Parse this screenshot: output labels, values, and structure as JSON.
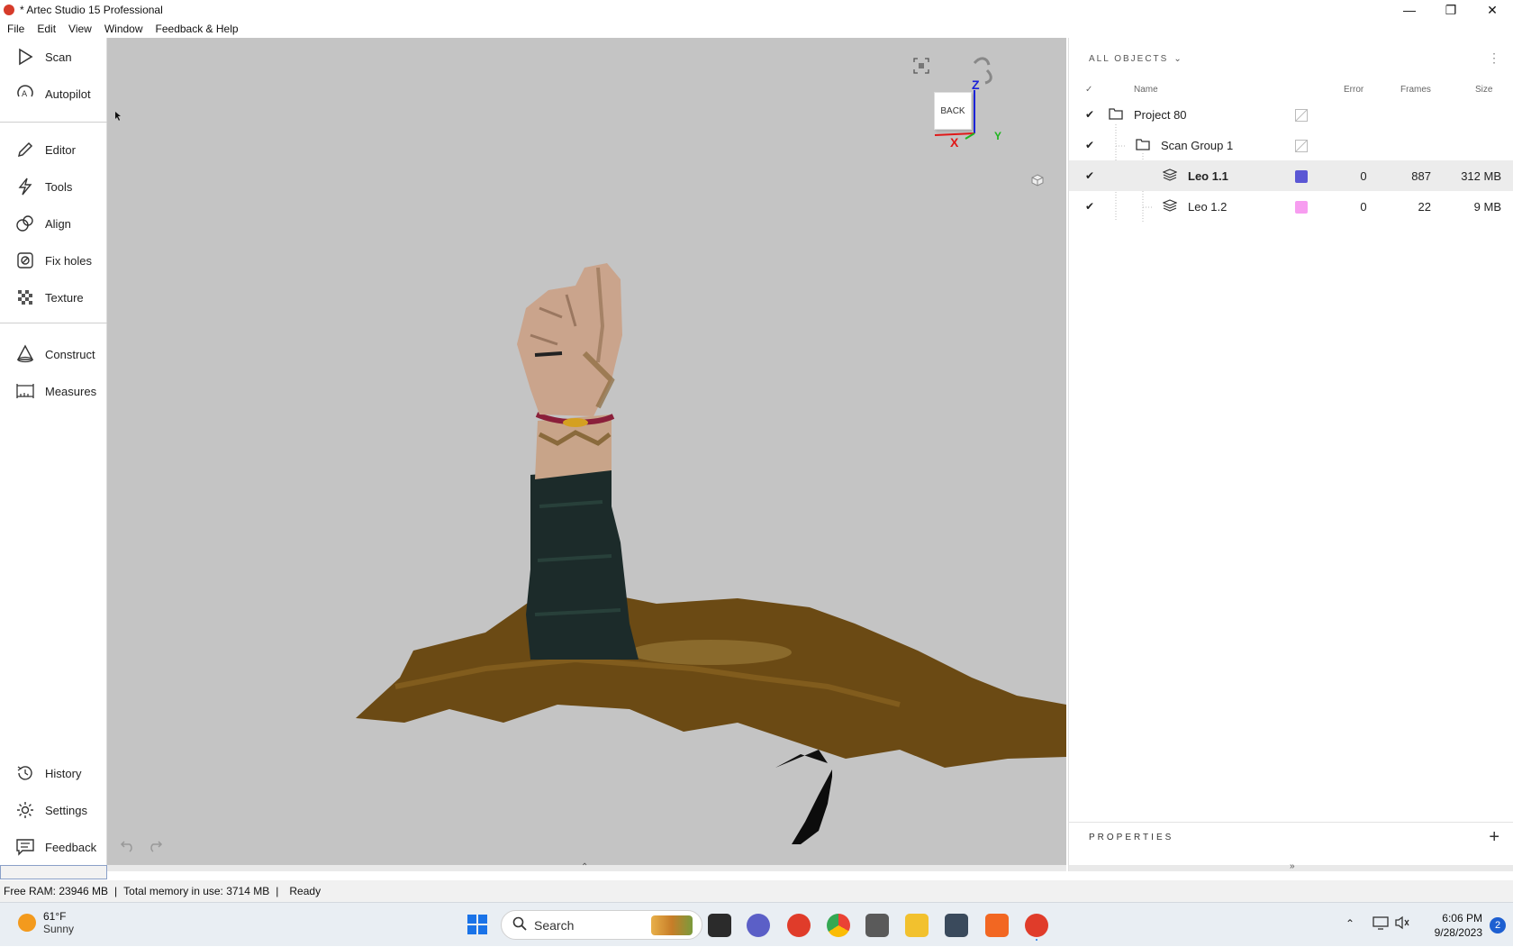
{
  "window": {
    "title": "* Artec Studio 15 Professional",
    "controls": [
      "—",
      "❐",
      "✕"
    ]
  },
  "menu": [
    "File",
    "Edit",
    "View",
    "Window",
    "Feedback & Help"
  ],
  "sidebar": {
    "items": [
      {
        "label": "Scan",
        "icon": "play-icon"
      },
      {
        "label": "Autopilot",
        "icon": "autopilot-icon"
      },
      {
        "label": "Editor",
        "icon": "pencil-icon"
      },
      {
        "label": "Tools",
        "icon": "lightning-icon"
      },
      {
        "label": "Align",
        "icon": "align-icon"
      },
      {
        "label": "Fix holes",
        "icon": "fix-holes-icon"
      },
      {
        "label": "Texture",
        "icon": "texture-icon"
      },
      {
        "label": "Construct",
        "icon": "cone-icon"
      },
      {
        "label": "Measures",
        "icon": "ruler-icon"
      },
      {
        "label": "History",
        "icon": "history-icon"
      },
      {
        "label": "Settings",
        "icon": "gear-icon"
      },
      {
        "label": "Feedback",
        "icon": "chat-icon"
      }
    ]
  },
  "viewport": {
    "bg": "#c4c4c4",
    "view_cube_label": "BACK",
    "axes": {
      "x": "X",
      "y": "Y",
      "z": "Z"
    }
  },
  "objects_panel": {
    "header": "ALL OBJECTS",
    "columns": {
      "name": "Name",
      "error": "Error",
      "frames": "Frames",
      "size": "Size"
    },
    "rows": [
      {
        "name": "Project 80",
        "error": "",
        "frames": "",
        "size": "",
        "color": ""
      },
      {
        "name": "Scan Group 1",
        "error": "",
        "frames": "",
        "size": "",
        "color": ""
      },
      {
        "name": "Leo 1.1",
        "error": "0",
        "frames": "887",
        "size": "312 MB",
        "color": "#5b57d4"
      },
      {
        "name": "Leo 1.2",
        "error": "0",
        "frames": "22",
        "size": "9 MB",
        "color": "#f79df0"
      }
    ],
    "properties_label": "PROPERTIES"
  },
  "status": {
    "free_ram": "Free RAM: 23946 MB",
    "total_memory": "Total memory in use: 3714 MB",
    "state": "Ready"
  },
  "taskbar": {
    "temperature": "61°F",
    "condition": "Sunny",
    "search_placeholder": "Search",
    "time": "6:06 PM",
    "date": "9/28/2023",
    "notifications": "2"
  }
}
